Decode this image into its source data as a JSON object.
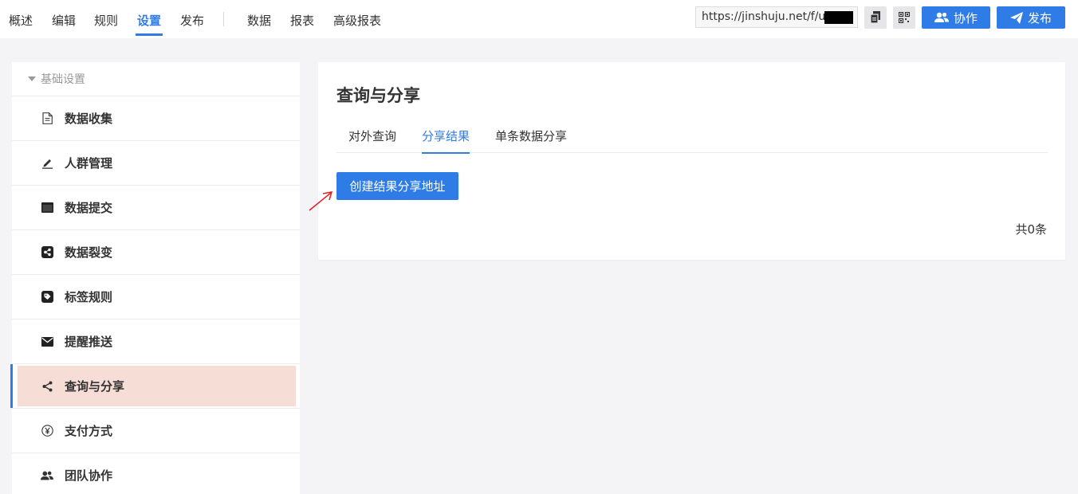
{
  "nav": {
    "tabs": [
      {
        "label": "概述"
      },
      {
        "label": "编辑"
      },
      {
        "label": "规则"
      },
      {
        "label": "设置",
        "active": true
      },
      {
        "label": "发布"
      }
    ],
    "tabs2": [
      {
        "label": "数据"
      },
      {
        "label": "报表"
      },
      {
        "label": "高级报表"
      }
    ]
  },
  "toolbar": {
    "url": "https://jinshuju.net/f/u",
    "copy_icon": "copy-icon",
    "qr_icon": "qrcode-icon",
    "collab_label": "协作",
    "publish_label": "发布"
  },
  "sidebar": {
    "section_title": "基础设置",
    "items": [
      {
        "label": "数据收集",
        "icon": "document-icon"
      },
      {
        "label": "人群管理",
        "icon": "pen-icon"
      },
      {
        "label": "数据提交",
        "icon": "window-icon"
      },
      {
        "label": "数据裂变",
        "icon": "share-square-icon"
      },
      {
        "label": "标签规则",
        "icon": "tag-icon"
      },
      {
        "label": "提醒推送",
        "icon": "envelope-icon"
      },
      {
        "label": "查询与分享",
        "icon": "share-icon",
        "active": true
      },
      {
        "label": "支付方式",
        "icon": "yen-icon"
      },
      {
        "label": "团队协作",
        "icon": "users-icon"
      }
    ]
  },
  "main": {
    "title": "查询与分享",
    "tabs": [
      {
        "label": "对外查询"
      },
      {
        "label": "分享结果",
        "active": true
      },
      {
        "label": "单条数据分享"
      }
    ],
    "create_button": "创建结果分享地址",
    "count_text": "共0条"
  },
  "colors": {
    "primary": "#2f7ce6",
    "active_item_bg": "#f6ddd6",
    "annotation_arrow": "#e02020"
  }
}
